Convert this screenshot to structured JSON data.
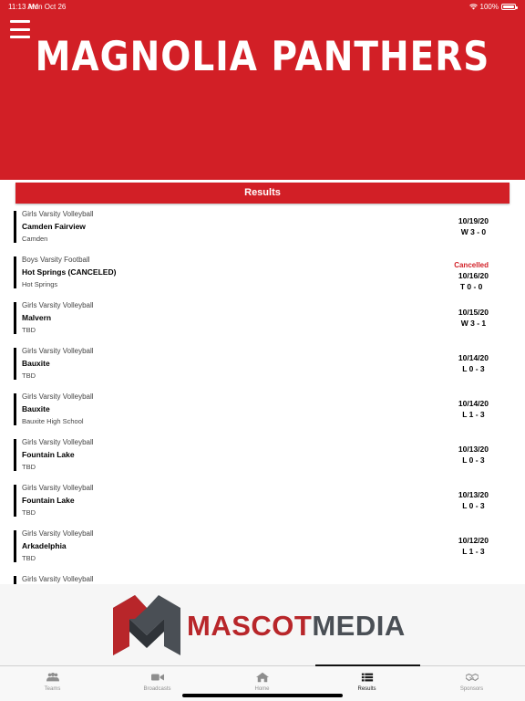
{
  "status_bar": {
    "time": "11:13 AM",
    "date": "Mon Oct 26",
    "battery": "100%"
  },
  "header": {
    "title": "MAGNOLIA PANTHERS"
  },
  "results": {
    "title": "Results"
  },
  "games": [
    {
      "sport": "Girls Varsity Volleyball",
      "opponent": "Camden Fairview",
      "location": "Camden",
      "status": "",
      "date": "10/19/20",
      "score": "W 3 - 0"
    },
    {
      "sport": "Boys Varsity Football",
      "opponent": "Hot Springs (CANCELED)",
      "location": "Hot Springs",
      "status": "Cancelled",
      "date": "10/16/20",
      "score": "T 0 - 0"
    },
    {
      "sport": "Girls Varsity Volleyball",
      "opponent": "Malvern",
      "location": "TBD",
      "status": "",
      "date": "10/15/20",
      "score": "W 3 - 1"
    },
    {
      "sport": "Girls Varsity Volleyball",
      "opponent": "Bauxite",
      "location": "TBD",
      "status": "",
      "date": "10/14/20",
      "score": "L 0 - 3"
    },
    {
      "sport": "Girls Varsity Volleyball",
      "opponent": "Bauxite",
      "location": "Bauxite High School",
      "status": "",
      "date": "10/14/20",
      "score": "L 1 - 3"
    },
    {
      "sport": "Girls Varsity Volleyball",
      "opponent": "Fountain Lake",
      "location": "TBD",
      "status": "",
      "date": "10/13/20",
      "score": "L 0 - 3"
    },
    {
      "sport": "Girls Varsity Volleyball",
      "opponent": "Fountain Lake",
      "location": "TBD",
      "status": "",
      "date": "10/13/20",
      "score": "L 0 - 3"
    },
    {
      "sport": "Girls Varsity Volleyball",
      "opponent": "Arkadelphia",
      "location": "TBD",
      "status": "",
      "date": "10/12/20",
      "score": "L 1 - 3"
    },
    {
      "sport": "Girls Varsity Volleyball",
      "opponent": "",
      "location": "",
      "status": "",
      "date": "",
      "score": ""
    }
  ],
  "sponsor": {
    "brand_part1": "MASCOT",
    "brand_part2": "MEDIA"
  },
  "tabs": [
    {
      "label": "Teams",
      "icon": "teams-icon"
    },
    {
      "label": "Broadcasts",
      "icon": "video-camera-icon"
    },
    {
      "label": "Home",
      "icon": "home-icon"
    },
    {
      "label": "Results",
      "icon": "list-icon"
    },
    {
      "label": "Sponsors",
      "icon": "handshake-icon"
    }
  ],
  "active_tab": "Results",
  "colors": {
    "brand_red": "#d21f26",
    "tab_inactive": "#8e8e8e"
  }
}
